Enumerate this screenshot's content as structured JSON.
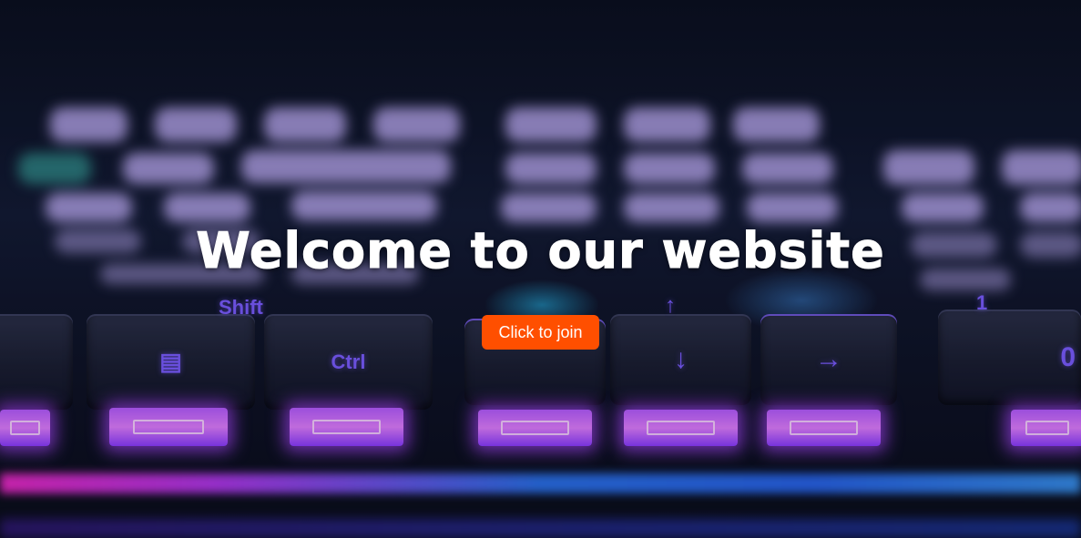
{
  "hero": {
    "headline": "Welcome to our website",
    "cta_label": "Click to join",
    "cta_color": "#ff4f00"
  },
  "background": {
    "description_icon": "keyboard-icon",
    "key_legends": {
      "shift": "Shift",
      "ctrl": "Ctrl",
      "menu": "▤",
      "up": "↑",
      "down": "↓",
      "right": "→",
      "one": "1",
      "zero": "0"
    }
  }
}
